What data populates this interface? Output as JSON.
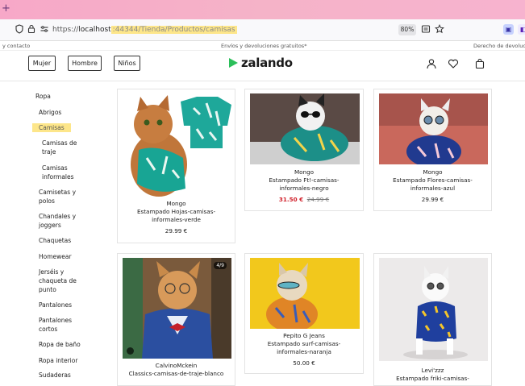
{
  "browser": {
    "url_prefix": "https://",
    "url_host": "localhost",
    "url_port_path": ":44344/Tienda/Productos/camisas",
    "zoom": "80%"
  },
  "promo": {
    "left": "y contacto",
    "center": "Envíos y devoluciones gratuitos*",
    "right": "Derecho de devoluci"
  },
  "header": {
    "gender_buttons": [
      "Mujer",
      "Hombre",
      "Niños"
    ],
    "logo_text": "zalando"
  },
  "sidebar": {
    "items": [
      {
        "label": "Ropa"
      },
      {
        "label": "Abrigos"
      },
      {
        "label": "Camisas",
        "active": true
      },
      {
        "label": "Camisas de traje"
      },
      {
        "label": "Camisas informales"
      },
      {
        "label": "Camisetas y polos"
      },
      {
        "label": "Chandales y joggers"
      },
      {
        "label": "Chaquetas"
      },
      {
        "label": "Homewear"
      },
      {
        "label": "Jerséis y chaqueta de punto"
      },
      {
        "label": "Pantalones"
      },
      {
        "label": "Pantalones cortos"
      },
      {
        "label": "Ropa de baño"
      },
      {
        "label": "Ropa interior"
      },
      {
        "label": "Sudaderas"
      }
    ]
  },
  "products": [
    {
      "brand": "Mongo",
      "name": "Estampado Hojas-camisas-informales-verde",
      "price": "29.99 €"
    },
    {
      "brand": "Mongo",
      "name": "Estampado Ft!-camisas-informales-negro",
      "price": "31.50 €",
      "old_price": "24.99 €"
    },
    {
      "brand": "Mongo",
      "name": "Estampado Flores-camisas-informales-azul",
      "price": "29.99 €"
    },
    {
      "brand": "CalvinoMckein",
      "name": "Classics-camisas-de-traje-blanco",
      "badge": "4/9"
    },
    {
      "brand": "Pepito G Jeans",
      "name": "Estampado surf-camisas-informales-naranja",
      "price": "50.00 €"
    },
    {
      "brand": "Levi'zzz",
      "name": "Estampado friki-camisas-"
    }
  ],
  "colors": {
    "highlight": "#fde68a",
    "brand_green": "#ff6900",
    "sale_red": "#d1212b"
  }
}
